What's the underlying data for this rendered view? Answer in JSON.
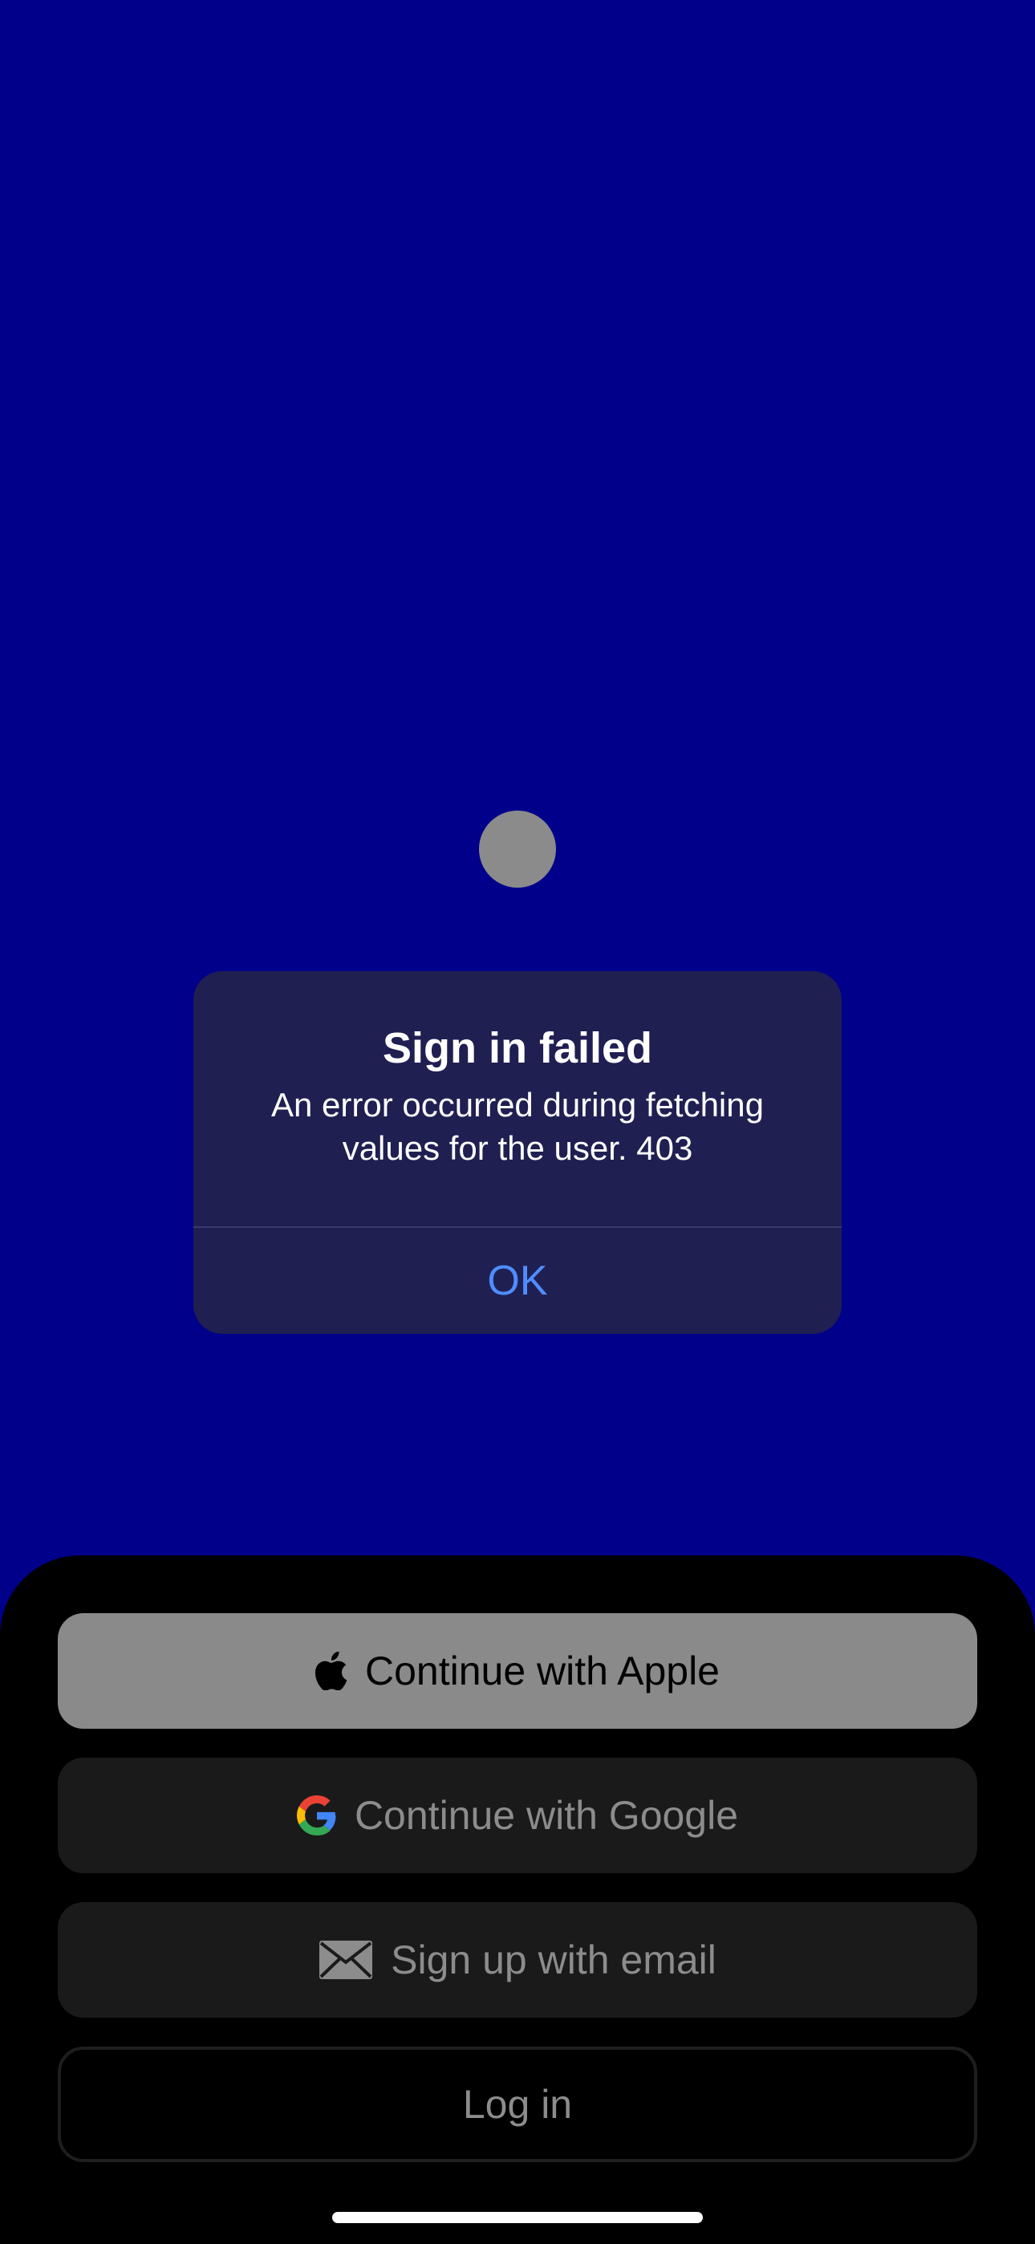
{
  "alert": {
    "title": "Sign in failed",
    "message": "An error occurred during fetching values for the user. 403",
    "ok_label": "OK"
  },
  "auth": {
    "apple_label": "Continue with Apple",
    "google_label": "Continue with Google",
    "email_label": "Sign up with email",
    "login_label": "Log in"
  },
  "icons": {
    "apple": "apple-icon",
    "google": "google-icon",
    "email": "envelope-icon"
  },
  "colors": {
    "background": "#01008a",
    "alert_bg": "#1f1f52",
    "alert_action": "#4f8dff",
    "apple_button": "#8a8a8a",
    "secondary_button": "#1a1a1a",
    "sheet": "#000000"
  }
}
